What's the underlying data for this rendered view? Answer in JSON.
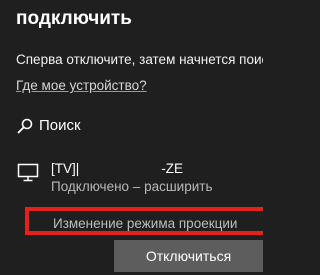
{
  "panel": {
    "title": "подключить",
    "instructions": "Сперва отключите, затем начнется поиск",
    "device_link": "Где мое устройство?",
    "search": {
      "icon": "search-icon",
      "label": "Поиск"
    },
    "device": {
      "icon": "monitor-icon",
      "name_prefix": "[TV]|",
      "name_suffix": "-ZE",
      "status": "Подключено – расширить"
    },
    "projection_link": "Изменение режима проекции",
    "disconnect_button": "Отключиться",
    "colors": {
      "background": "#1f1f1f",
      "highlight_border": "#e3231b",
      "button_background": "#5d5d5d"
    }
  }
}
